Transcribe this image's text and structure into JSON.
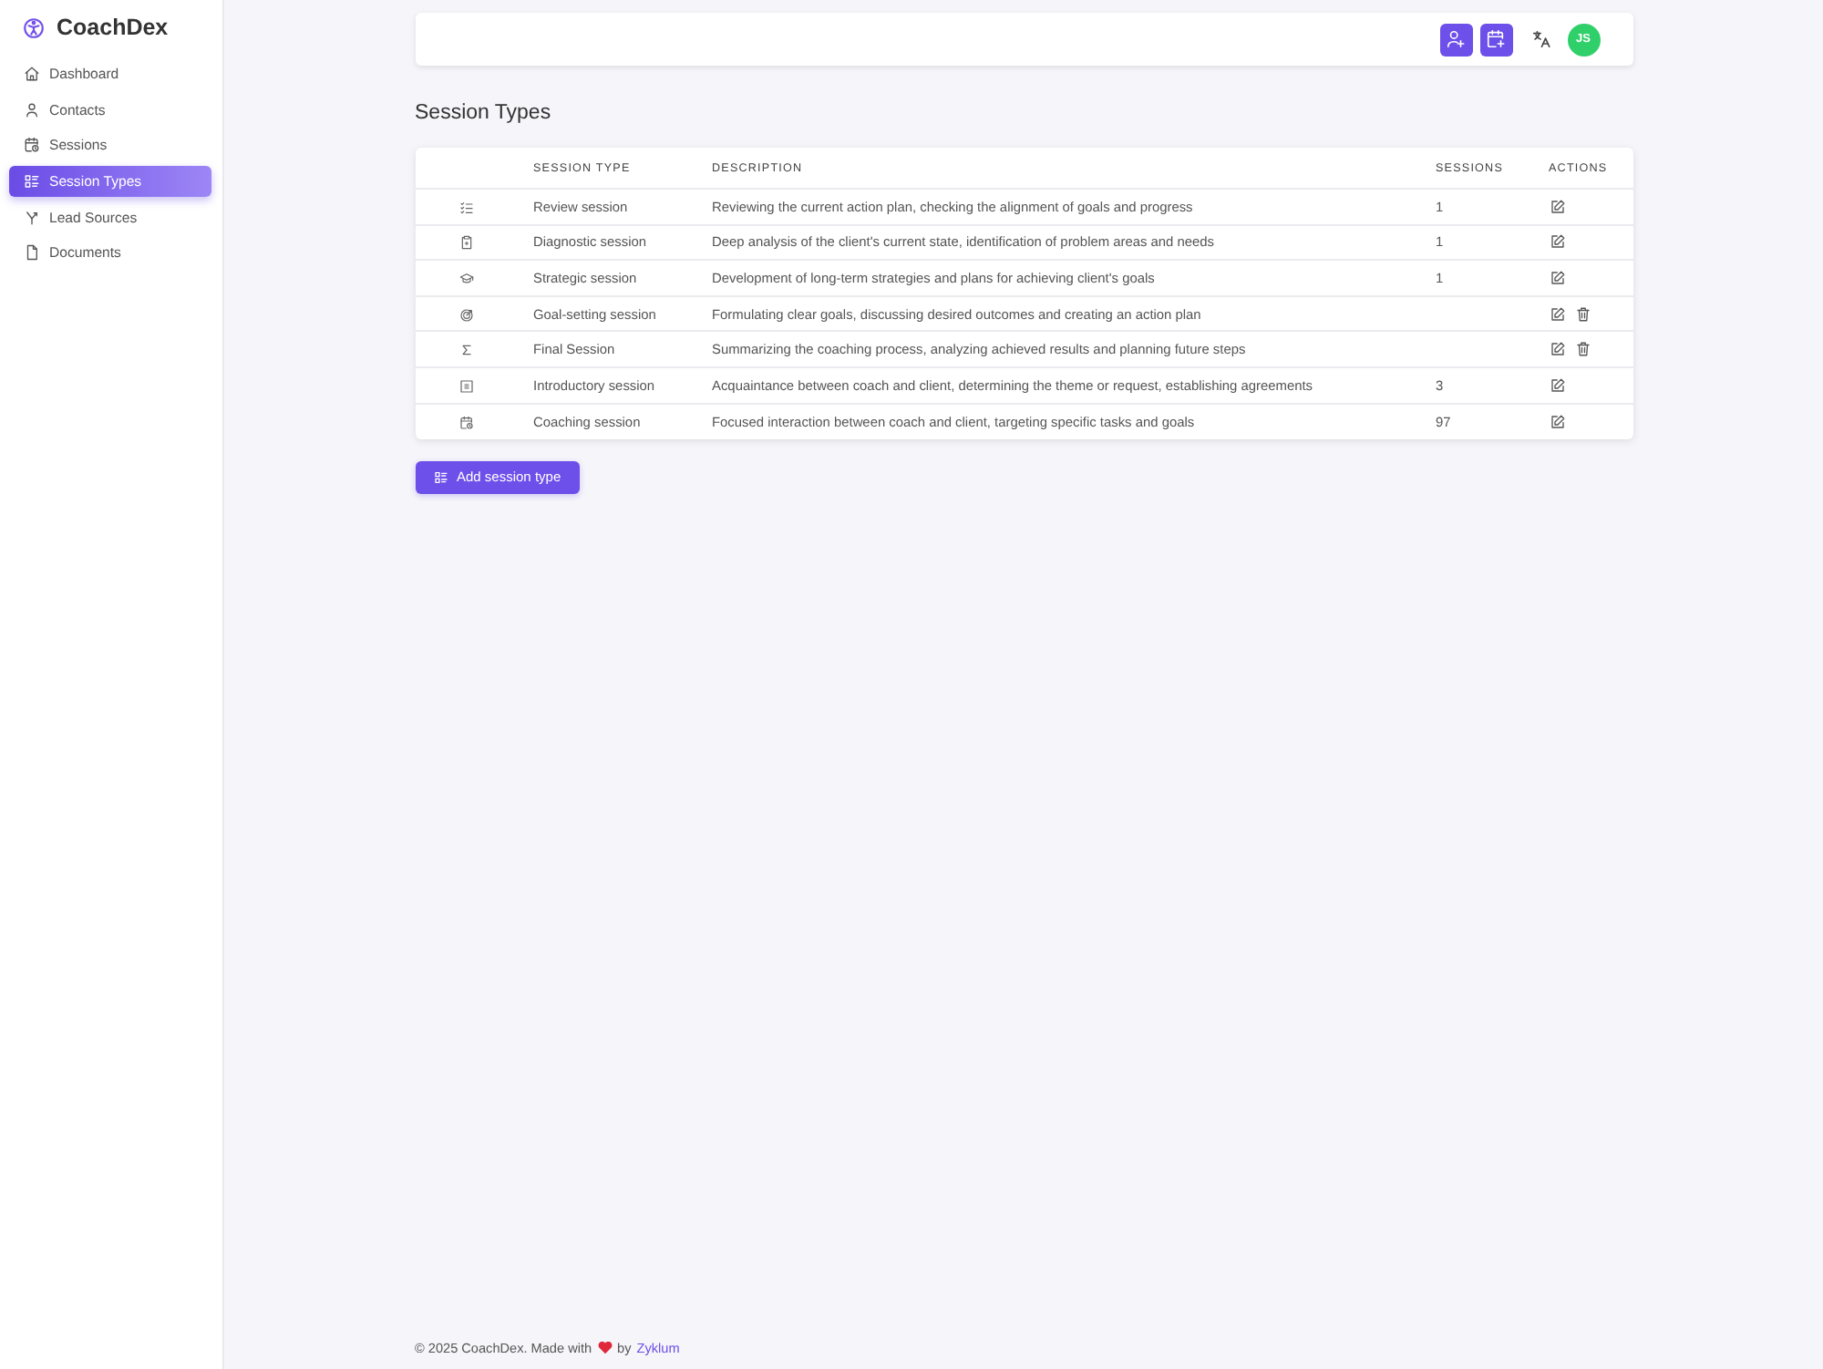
{
  "app": {
    "title": "CoachDex"
  },
  "sidebar": {
    "items": [
      {
        "label": "Dashboard",
        "selected": false
      },
      {
        "label": "Contacts",
        "selected": false
      },
      {
        "label": "Sessions",
        "selected": false
      },
      {
        "label": "Session Types",
        "selected": true
      },
      {
        "label": "Lead Sources",
        "selected": false
      },
      {
        "label": "Documents",
        "selected": false
      }
    ]
  },
  "top_bar": {
    "avatar": "JS"
  },
  "page_title": "Session Types",
  "table": {
    "columns": [
      "SESSION TYPE",
      "DESCRIPTION",
      "SESSIONS",
      "ACTIONS"
    ],
    "rows": [
      {
        "name": "Review session",
        "description": "Reviewing the current action plan, checking the alignment of goals and progress",
        "sessions": "1",
        "deletable": false
      },
      {
        "name": "Diagnostic session",
        "description": "Deep analysis of the client's current state, identification of problem areas and needs",
        "sessions": "1",
        "deletable": false
      },
      {
        "name": "Strategic session",
        "description": "Development of long-term strategies and plans for achieving client's goals",
        "sessions": "1",
        "deletable": false
      },
      {
        "name": "Goal-setting session",
        "description": "Formulating clear goals, discussing desired outcomes and creating an action plan",
        "deletable": true
      },
      {
        "name": "Final Session",
        "description": "Summarizing the coaching process, analyzing achieved results and planning future steps",
        "deletable": true
      },
      {
        "name": "Introductory session",
        "description": "Acquaintance between coach and client, determining the theme or request, establishing agreements",
        "sessions": "3",
        "deletable": false
      },
      {
        "name": "Coaching session",
        "description": "Focused interaction between coach and client, targeting specific tasks and goals",
        "sessions": "97",
        "deletable": false
      }
    ]
  },
  "add_button": "Add session type",
  "footer": {
    "text": "© 2025 CoachDex. Made with",
    "by": "by",
    "link": "Zyklum"
  }
}
